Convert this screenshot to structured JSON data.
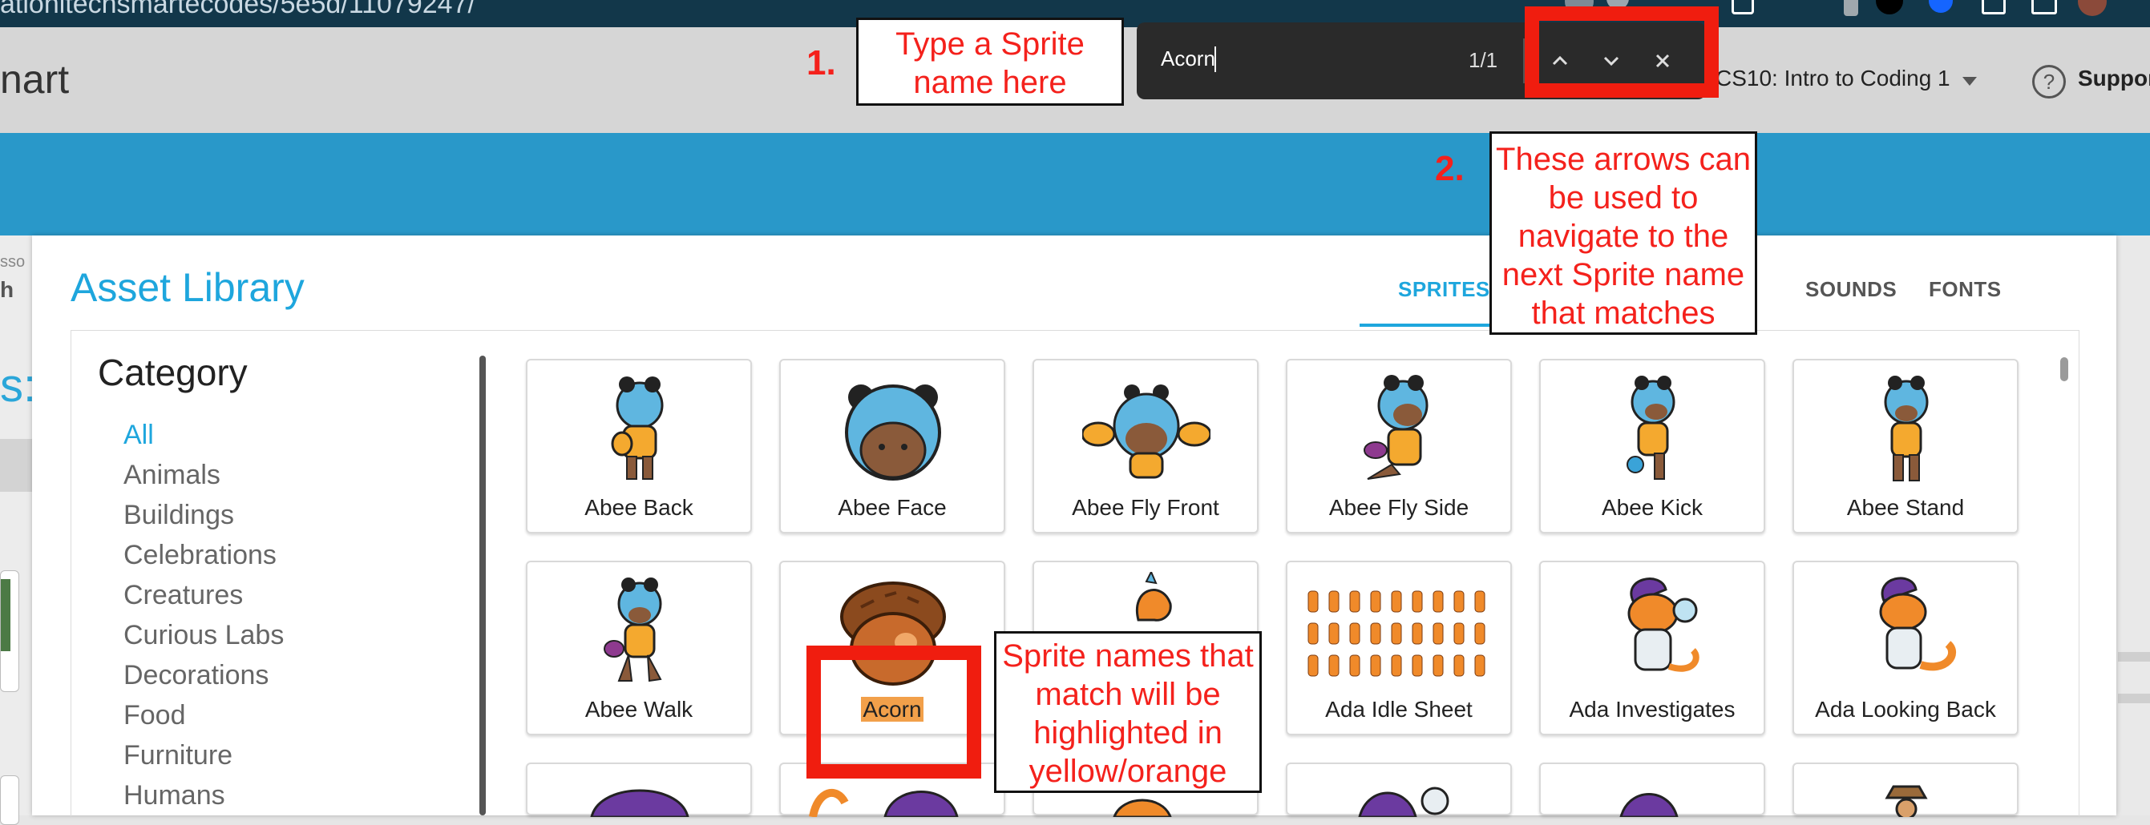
{
  "browser": {
    "url_fragment": "ationitechsmartecodes/5e5d/11079247/",
    "icon_names": [
      "extension-icon",
      "extension-icon",
      "puzzle-icon",
      "profile-icon",
      "shield-icon",
      "extension-icon",
      "window-icon",
      "avatar-icon"
    ]
  },
  "header": {
    "logo_fragment": "nart",
    "course": "CS10: Intro to Coding 1",
    "support": "Suppor"
  },
  "side_fragments": [
    "sso",
    "h",
    "s:"
  ],
  "find_bar": {
    "query": "Acorn",
    "count": "1/1"
  },
  "modal": {
    "title": "Asset Library",
    "tabs": [
      "SPRITES",
      "SOUNDS",
      "FONTS"
    ]
  },
  "category": {
    "title": "Category",
    "items": [
      "All",
      "Animals",
      "Buildings",
      "Celebrations",
      "Creatures",
      "Curious Labs",
      "Decorations",
      "Food",
      "Furniture",
      "Humans"
    ]
  },
  "sprites": [
    {
      "name": "Abee Back",
      "icon": "abee-back-sprite"
    },
    {
      "name": "Abee Face",
      "icon": "abee-face-sprite"
    },
    {
      "name": "Abee Fly Front",
      "icon": "abee-fly-front-sprite"
    },
    {
      "name": "Abee Fly Side",
      "icon": "abee-fly-side-sprite"
    },
    {
      "name": "Abee Kick",
      "icon": "abee-kick-sprite"
    },
    {
      "name": "Abee Stand",
      "icon": "abee-stand-sprite"
    },
    {
      "name": "Abee Walk",
      "icon": "abee-walk-sprite"
    },
    {
      "name": "Acorn",
      "icon": "acorn-sprite",
      "highlighted": true
    },
    {
      "name": "",
      "icon": "ada-sprite"
    },
    {
      "name": "Ada Idle Sheet",
      "icon": "ada-idle-sheet-sprite"
    },
    {
      "name": "Ada Investigates",
      "icon": "ada-investigates-sprite"
    },
    {
      "name": "Ada Looking Back",
      "icon": "ada-looking-back-sprite"
    }
  ],
  "annotations": {
    "step1_number": "1.",
    "step1_text": "Type a Sprite name here",
    "step2_number": "2.",
    "step2_text": "These arrows can be used to navigate to the next Sprite name that matches",
    "highlight_text": "Sprite names that match will be highlighted in yellow/orange"
  },
  "colors": {
    "accent": "#1ea6dd",
    "band": "#2998c9",
    "annotation_red": "#f01d0f",
    "highlight": "#f2a04a"
  }
}
